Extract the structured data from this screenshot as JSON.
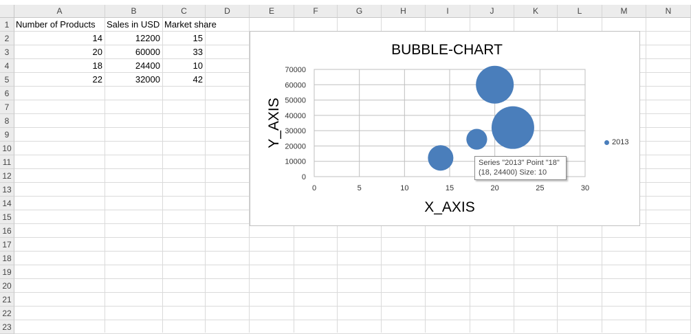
{
  "spreadsheet": {
    "columns": [
      "A",
      "B",
      "C",
      "D",
      "E",
      "F",
      "G",
      "H",
      "I",
      "J",
      "K",
      "L",
      "M",
      "N"
    ],
    "rows": [
      "1",
      "2",
      "3",
      "4",
      "5",
      "6",
      "7",
      "8",
      "9",
      "10",
      "11",
      "12",
      "13",
      "14",
      "15",
      "16",
      "17",
      "18",
      "19",
      "20",
      "21",
      "22",
      "23"
    ],
    "headers": {
      "a": "Number of Products",
      "b": "Sales in USD",
      "c": "Market share"
    },
    "data": [
      {
        "a": "14",
        "b": "12200",
        "c": "15"
      },
      {
        "a": "20",
        "b": "60000",
        "c": "33"
      },
      {
        "a": "18",
        "b": "24400",
        "c": "10"
      },
      {
        "a": "22",
        "b": "32000",
        "c": "42"
      }
    ]
  },
  "chart_data": {
    "type": "scatter",
    "subtype": "bubble",
    "title": "BUBBLE-CHART",
    "xlabel": "X_AXIS",
    "ylabel": "Y_AXIS",
    "xlim": [
      0,
      30
    ],
    "ylim": [
      0,
      70000
    ],
    "x_ticks": [
      "0",
      "5",
      "10",
      "15",
      "20",
      "25",
      "30"
    ],
    "y_ticks": [
      "0",
      "10000",
      "20000",
      "30000",
      "40000",
      "50000",
      "60000",
      "70000"
    ],
    "grid": true,
    "legend_position": "right",
    "series": [
      {
        "name": "2013",
        "color": "#4a7ebb",
        "points": [
          {
            "x": 14,
            "y": 12200,
            "size": 15
          },
          {
            "x": 20,
            "y": 60000,
            "size": 33
          },
          {
            "x": 18,
            "y": 24400,
            "size": 10
          },
          {
            "x": 22,
            "y": 32000,
            "size": 42
          }
        ]
      }
    ]
  },
  "tooltip": {
    "line1": "Series \"2013\" Point \"18\"",
    "line2": "(18, 24400) Size: 10"
  }
}
